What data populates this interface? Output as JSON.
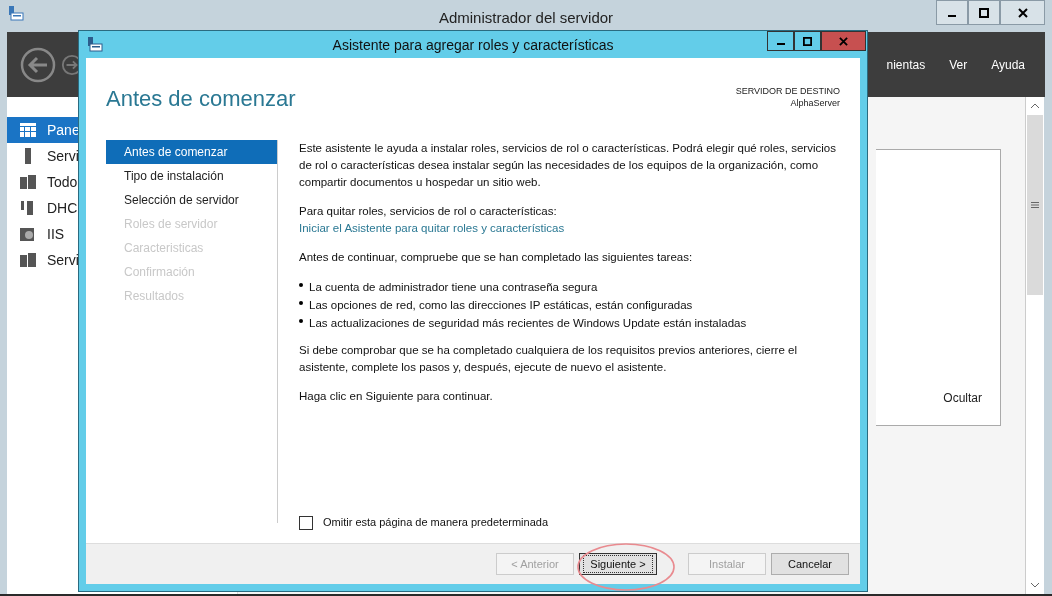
{
  "server_window": {
    "title": "Administrador del servidor",
    "menu": [
      "nientas",
      "Ver",
      "Ayuda"
    ],
    "nav": [
      {
        "label": "Pane",
        "selected": true
      },
      {
        "label": "Servi",
        "selected": false
      },
      {
        "label": "Todo",
        "selected": false
      },
      {
        "label": "DHC",
        "selected": false
      },
      {
        "label": "IIS",
        "selected": false
      },
      {
        "label": "Servi",
        "selected": false
      }
    ],
    "panel_link": "Ocultar"
  },
  "wizard": {
    "title": "Asistente para agregar roles y características",
    "heading": "Antes de comenzar",
    "destination_label": "SERVIDOR DE DESTINO",
    "destination_server": "AlphaServer",
    "steps": [
      {
        "label": "Antes de comenzar",
        "selected": true,
        "disabled": false
      },
      {
        "label": "Tipo de instalación",
        "selected": false,
        "disabled": false
      },
      {
        "label": "Selección de servidor",
        "selected": false,
        "disabled": false
      },
      {
        "label": "Roles de servidor",
        "selected": false,
        "disabled": true
      },
      {
        "label": "Caracteristicas",
        "selected": false,
        "disabled": true
      },
      {
        "label": "Confirmación",
        "selected": false,
        "disabled": true
      },
      {
        "label": "Resultados",
        "selected": false,
        "disabled": true
      }
    ],
    "intro": "Este asistente le ayuda a instalar roles, servicios de rol o características. Podrá elegir qué roles, servicios de rol o características desea instalar según las necesidades de los equipos de la organización, como compartir documentos u hospedar un sitio web.",
    "remove_prompt": "Para quitar roles, servicios de rol o características:",
    "remove_link": "Iniciar el Asistente para quitar roles y características",
    "check_prompt": "Antes de continuar, compruebe que se han completado las siguientes tareas:",
    "tasks": [
      "La cuenta de administrador tiene una contraseña segura",
      "Las opciones de red, como las direcciones IP estáticas, están configuradas",
      "Las actualizaciones de seguridad más recientes de Windows Update están instaladas"
    ],
    "note": "Si debe comprobar que se ha completado cualquiera de los requisitos previos anteriores, cierre el asistente, complete los pasos y, después, ejecute de nuevo el asistente.",
    "continue_hint": "Haga clic en Siguiente para continuar.",
    "skip_checkbox": {
      "label": "Omitir esta página de manera predeterminada",
      "checked": false
    },
    "buttons": [
      {
        "label": "< Anterior",
        "disabled": true,
        "focused": false
      },
      {
        "label": "Siguiente >",
        "disabled": false,
        "focused": true
      },
      {
        "label": "Instalar",
        "disabled": true,
        "focused": false
      },
      {
        "label": "Cancelar",
        "disabled": false,
        "focused": false
      }
    ]
  }
}
